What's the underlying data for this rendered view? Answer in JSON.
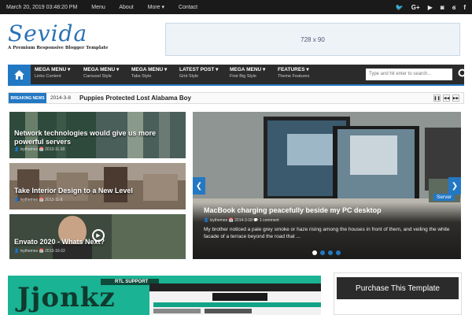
{
  "topbar": {
    "date": "March 20, 2019 03:48:20 PM",
    "menu": [
      "Menu",
      "About",
      "More ▾",
      "Contact"
    ],
    "social_icons": [
      "twitter-icon",
      "google-plus-icon",
      "youtube-icon",
      "rss-icon",
      "lastfm-icon",
      "facebook-icon"
    ]
  },
  "header": {
    "logo_name": "Sevida",
    "logo_tagline": "A Premium Responsive Blogger Template",
    "ad_label": "728 x 90"
  },
  "nav": {
    "items": [
      {
        "title": "MEGA MENU ▾",
        "sub": "Links Content"
      },
      {
        "title": "MEGA MENU ▾",
        "sub": "Carousel Style"
      },
      {
        "title": "MEGA MENU ▾",
        "sub": "Tabs Style"
      },
      {
        "title": "LATEST POST ▾",
        "sub": "Grid Style"
      },
      {
        "title": "MEGA MENU ▾",
        "sub": "First Big Style"
      },
      {
        "title": "FEATURES ▾",
        "sub": "Theme Features"
      }
    ],
    "search_placeholder": "Type and hit enter to search..."
  },
  "breaking": {
    "label": "BREAKING NEWS",
    "date": "2014-3-8",
    "text": "Puppies Protected Lost Alabama Boy"
  },
  "posts": [
    {
      "title": "Network technologies would give us more powerful servers",
      "author": "ivythemes",
      "date": "2013-11-30"
    },
    {
      "title": "Take Interior Design to a New Level",
      "author": "ivythemes",
      "date": "2013-11-8"
    },
    {
      "title": "Envato 2020 - Whats Next?",
      "author": "ivythemes",
      "date": "2013-10-22"
    }
  ],
  "slider": {
    "title": "MacBook charging peacefully beside my PC desktop",
    "author": "ivythemes",
    "date": "2014-3-18",
    "comments": "1 comment",
    "excerpt": "My brother noticed a pale grey smoke or haze rising among the houses in front of them, and veiling the white facade of a terrace beyond the road that ...",
    "tag": "Server"
  },
  "bottom": {
    "promo_logo": "Jjonkz",
    "rtl_badge": "RTL SUPPORT",
    "purchase": "Purchase This Template"
  },
  "colors": {
    "accent": "#2378c4",
    "dark": "#2b2b2b",
    "promo": "#1ab394"
  }
}
